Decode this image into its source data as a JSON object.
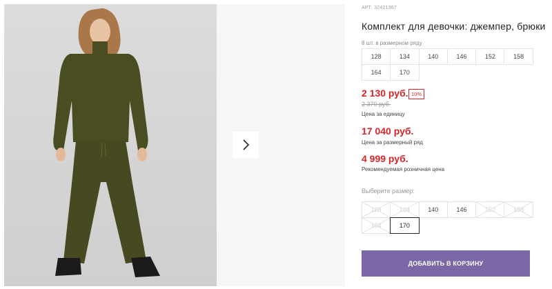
{
  "product": {
    "article": "АРТ: 32421367",
    "title": "Комплект для девочки: джемпер, брюки",
    "pack_label": "8 шт. в размерном ряду",
    "pack_sizes": [
      "128",
      "134",
      "140",
      "146",
      "152",
      "158",
      "164",
      "170"
    ]
  },
  "pricing": {
    "price": "2 130 руб.",
    "discount_badge": "10%",
    "old_price": "2 370 руб.",
    "unit_caption": "Цена за единицу",
    "pack_price": "17 040 руб.",
    "pack_caption": "Цена за размерный ряд",
    "retail_price": "4 999 руб.",
    "retail_caption": "Рекомендуемая розничная цена"
  },
  "size_select": {
    "label": "Выберите размер:",
    "sizes": [
      {
        "label": "128",
        "available": false,
        "selected": false
      },
      {
        "label": "134",
        "available": false,
        "selected": false
      },
      {
        "label": "140",
        "available": true,
        "selected": false
      },
      {
        "label": "146",
        "available": true,
        "selected": false
      },
      {
        "label": "152",
        "available": false,
        "selected": false
      },
      {
        "label": "158",
        "available": false,
        "selected": false
      },
      {
        "label": "164",
        "available": false,
        "selected": false
      },
      {
        "label": "170",
        "available": true,
        "selected": true
      }
    ]
  },
  "actions": {
    "add_to_cart": "ДОБАВИТЬ В КОРЗИНУ"
  },
  "icons": {
    "next": "chevron-right-icon"
  },
  "colors": {
    "accent_red": "#d8232a",
    "button_purple": "#7b67a6",
    "outfit_green": "#4a4d22"
  }
}
